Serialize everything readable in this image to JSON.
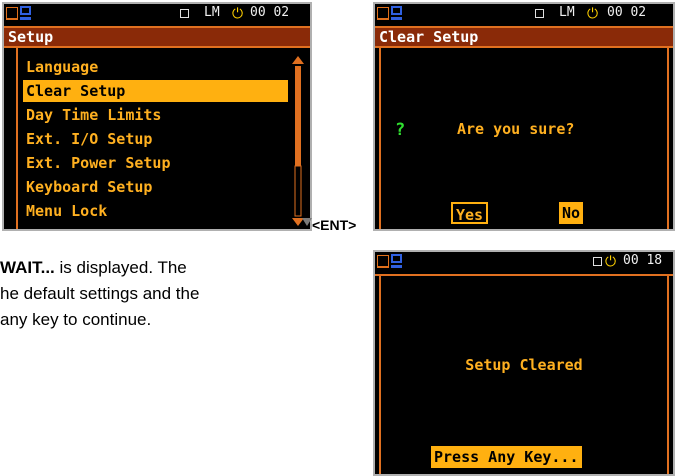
{
  "screen1": {
    "status_text": "LM",
    "status_time": "00 02",
    "title": "Setup",
    "items": [
      "Language",
      "Clear Setup",
      "Day Time Limits",
      "Ext. I/O Setup",
      "Ext. Power Setup",
      "Keyboard Setup",
      "Menu Lock"
    ],
    "selected_index": 1
  },
  "ent_label": "<ENT>",
  "screen2": {
    "status_text": "LM",
    "status_time": "00 02",
    "title": "Clear Setup",
    "question_mark": "?",
    "question": "Are you sure?",
    "yes_label": "Yes",
    "no_label": "No"
  },
  "screen3": {
    "status_time": "00 18",
    "message": "Setup Cleared",
    "press_key": "Press Any Key..."
  },
  "caption": {
    "line1_bold": "WAIT...",
    "line1_rest": " is displayed. The",
    "line2": "he default settings and the",
    "line3": "any key to continue."
  },
  "colors": {
    "accent": "#e07020",
    "highlight": "#ffb010",
    "text_orange": "#ffb020",
    "title_bg": "#8a2a08"
  }
}
